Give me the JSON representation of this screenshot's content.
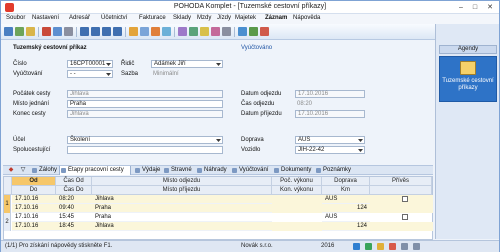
{
  "window": {
    "title": "POHODA Komplet - [Tuzemské cestovní příkazy]",
    "minimize": "–",
    "maximize": "□",
    "close": "✕"
  },
  "menu": [
    "Soubor",
    "Nastavení",
    "Adresář",
    "Účetnictví",
    "Fakturace",
    "Sklady",
    "Mzdy",
    "Jízdy",
    "Majetek",
    "Záznam",
    "Nápověda"
  ],
  "agendy": {
    "header": "Agendy",
    "item_label": "Tuzemské cestovní příkazy"
  },
  "form": {
    "heading": "Tuzemský cestovní příkaz",
    "status": "Vyúčtováno",
    "cislo_label": "Číslo",
    "cislo_value": "16CPT00001",
    "vyuctovani_label": "Vyúčtování",
    "vyuctovani_value": "- -",
    "ridic_label": "Řidič",
    "ridic_value": "Adámek Jiří",
    "sazba_label": "Sazba",
    "sazba_value": "Minimální",
    "pocatek_label": "Počátek cesty",
    "pocatek_value": "Jihlava",
    "misto_label": "Místo jednání",
    "misto_value": "Praha",
    "konec_label": "Konec cesty",
    "konec_value": "Jihlava",
    "datum_odjezdu_label": "Datum odjezdu",
    "datum_odjezdu_value": "17.10.2016",
    "cas_odjezdu_label": "Čas odjezdu",
    "cas_odjezdu_value": "08:20",
    "datum_prijezdu_label": "Datum příjezdu",
    "datum_prijezdu_value": "17.10.2016",
    "ucel_label": "Účel",
    "ucel_value": "Školení",
    "spolucestujici_label": "Spolucestující",
    "doprava_label": "Doprava",
    "doprava_value": "AUS",
    "vozidlo_label": "Vozidlo",
    "vozidlo_value": "JIH-22-42"
  },
  "subtabs": [
    "Zálohy",
    "Etapy pracovní cesty",
    "Výdaje",
    "Stravné",
    "Náhrady",
    "Vyúčtování",
    "Dokumenty",
    "Poznámky"
  ],
  "grid": {
    "headers_top": [
      "Od",
      "Čas Od",
      "Místo odjezdu",
      "Poč. výkonu",
      "Doprava",
      "Přívěs"
    ],
    "headers_bottom": [
      "Do",
      "Čas Do",
      "Místo příjezdu",
      "Kon. výkonu",
      "Km"
    ],
    "rows": [
      {
        "num": "1",
        "od_date": "17.10.16",
        "od_time": "08:20",
        "od_place": "Jihlava",
        "do_date": "17.10.16",
        "do_time": "09:40",
        "do_place": "Praha",
        "doprava": "AUS",
        "km": "124"
      },
      {
        "num": "2",
        "od_date": "17.10.16",
        "od_time": "15:45",
        "od_place": "Praha",
        "do_date": "17.10.16",
        "do_time": "18:45",
        "do_place": "Jihlava",
        "doprava": "AUS",
        "km": "124"
      }
    ]
  },
  "status": {
    "help": "(1/1) Pro získání nápovědy stiskněte F1.",
    "company": "Novák s.r.o.",
    "year": "2016"
  }
}
